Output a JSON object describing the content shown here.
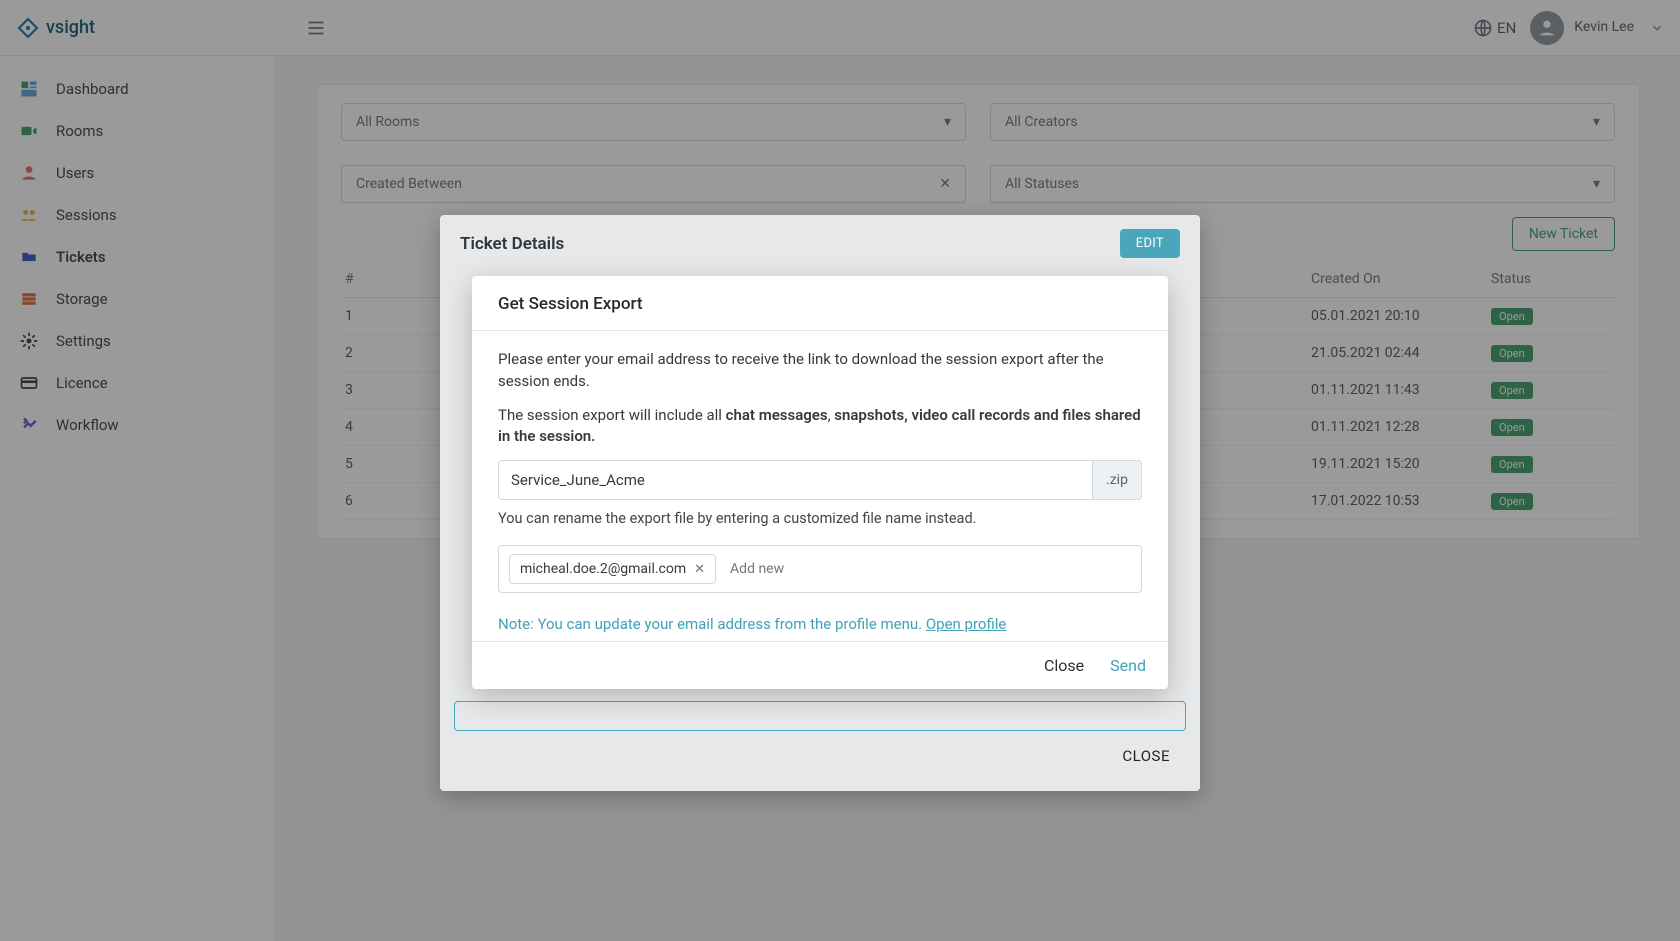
{
  "brand": "vsight",
  "lang_label": "EN",
  "user": {
    "name": "Kevin Lee"
  },
  "sidebar": {
    "items": [
      {
        "label": "Dashboard"
      },
      {
        "label": "Rooms"
      },
      {
        "label": "Users"
      },
      {
        "label": "Sessions"
      },
      {
        "label": "Tickets"
      },
      {
        "label": "Storage"
      },
      {
        "label": "Settings"
      },
      {
        "label": "Licence"
      },
      {
        "label": "Workflow"
      }
    ]
  },
  "filters": {
    "rooms": "All Rooms",
    "creators": "All Creators",
    "created_between": "Created Between",
    "statuses": "All Statuses"
  },
  "new_ticket_label": "New Ticket",
  "table": {
    "col_hash": "#",
    "col_created": "Created On",
    "col_status": "Status",
    "rows": [
      {
        "n": "1",
        "created": "05.01.2021 20:10",
        "status": "Open"
      },
      {
        "n": "2",
        "created": "21.05.2021 02:44",
        "status": "Open"
      },
      {
        "n": "3",
        "created": "01.11.2021 11:43",
        "status": "Open"
      },
      {
        "n": "4",
        "created": "01.11.2021 12:28",
        "status": "Open"
      },
      {
        "n": "5",
        "created": "19.11.2021 15:20",
        "status": "Open"
      },
      {
        "n": "6",
        "created": "17.01.2022 10:53",
        "status": "Open"
      }
    ]
  },
  "outer_dialog": {
    "title": "Ticket Details",
    "edit": "EDIT",
    "close": "CLOSE"
  },
  "inner_dialog": {
    "title": "Get Session Export",
    "intro": "Please enter your email address to receive the link to download the session export after the session ends.",
    "includes_prefix": "The session export will include all ",
    "includes_bold1": "chat messages",
    "includes_sep": ", ",
    "includes_bold2": "snapshots, video call records and files shared in the session.",
    "filename": "Service_June_Acme",
    "suffix": ".zip",
    "rename_hint": "You can rename the export file by entering a customized file name instead.",
    "email_chip": "micheal.doe.2@gmail.com",
    "add_new_placeholder": "Add new",
    "note_text": "Note: You can update your email address from the profile menu. ",
    "note_link": "Open profile",
    "close": "Close",
    "send": "Send"
  }
}
